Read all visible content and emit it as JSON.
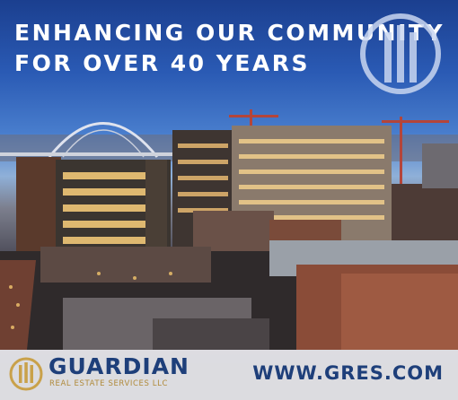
{
  "headline": {
    "line1": "ENHANCING OUR COMMUNITY",
    "line2": "FOR OVER 40 YEARS"
  },
  "footer": {
    "brand_name": "GUARDIAN",
    "tagline": "REAL ESTATE SERVICES LLC",
    "website": "WWW.GRES.COM"
  },
  "colors": {
    "brand_blue": "#1e3f7a",
    "brand_gold": "#b08a3a",
    "headline_text": "#ffffff"
  },
  "icons": [
    "guardian-logo-icon"
  ]
}
